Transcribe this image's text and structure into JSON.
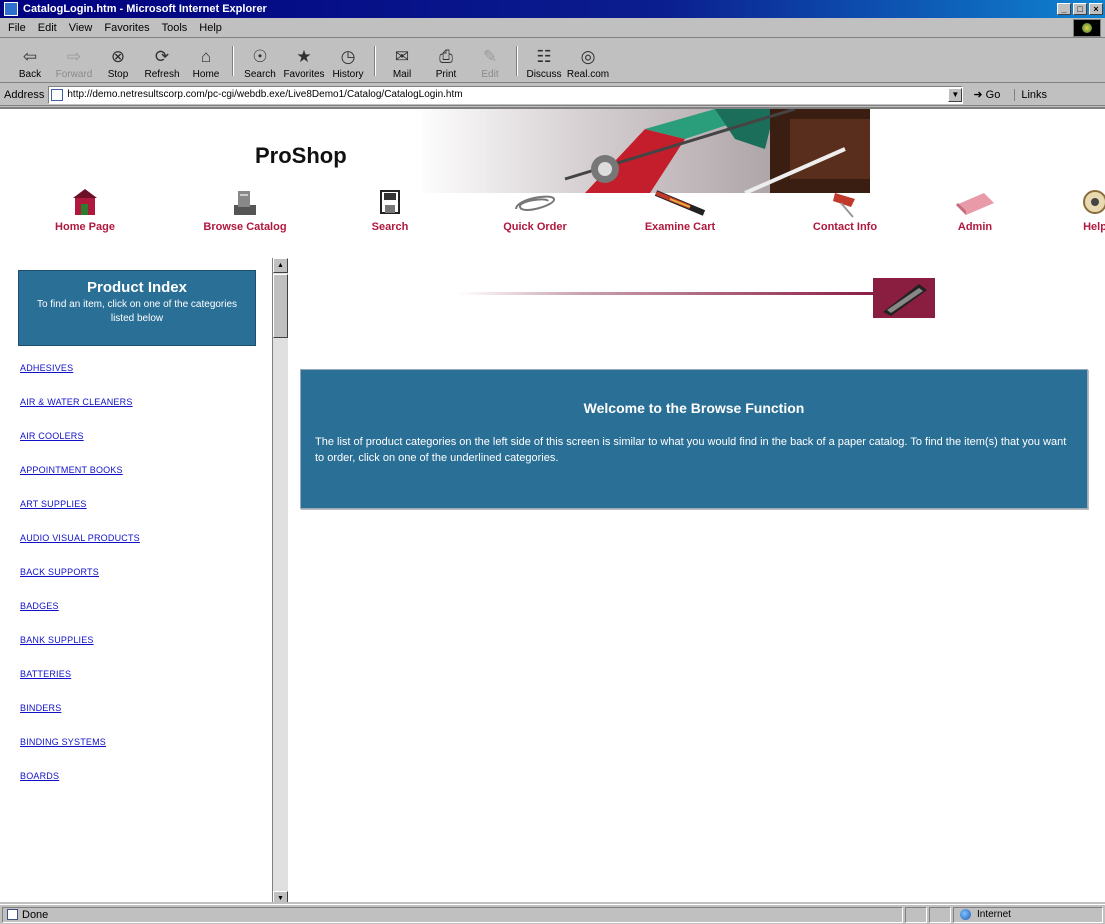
{
  "window": {
    "title": "CatalogLogin.htm - Microsoft Internet Explorer",
    "controls": [
      "_",
      "□",
      "×"
    ]
  },
  "menu": [
    "File",
    "Edit",
    "View",
    "Favorites",
    "Tools",
    "Help"
  ],
  "toolbar": [
    {
      "label": "Back",
      "icon": "back-arrow-icon",
      "glyph": "⇦",
      "enabled": true
    },
    {
      "label": "Forward",
      "icon": "forward-arrow-icon",
      "glyph": "⇨",
      "enabled": false
    },
    {
      "label": "Stop",
      "icon": "stop-icon",
      "glyph": "⊗",
      "enabled": true
    },
    {
      "label": "Refresh",
      "icon": "refresh-icon",
      "glyph": "⟳",
      "enabled": true
    },
    {
      "label": "Home",
      "icon": "home-icon",
      "glyph": "⌂",
      "enabled": true
    },
    {
      "label": "Search",
      "icon": "search-icon",
      "glyph": "☉",
      "enabled": true
    },
    {
      "label": "Favorites",
      "icon": "favorites-icon",
      "glyph": "★",
      "enabled": true
    },
    {
      "label": "History",
      "icon": "history-icon",
      "glyph": "◷",
      "enabled": true
    },
    {
      "label": "Mail",
      "icon": "mail-icon",
      "glyph": "✉",
      "enabled": true
    },
    {
      "label": "Print",
      "icon": "print-icon",
      "glyph": "⎙",
      "enabled": true
    },
    {
      "label": "Edit",
      "icon": "edit-icon",
      "glyph": "✎",
      "enabled": false
    },
    {
      "label": "Discuss",
      "icon": "discuss-icon",
      "glyph": "☷",
      "enabled": true
    },
    {
      "label": "Real.com",
      "icon": "realcom-icon",
      "glyph": "◎",
      "enabled": true
    }
  ],
  "address": {
    "label": "Address",
    "url": "http://demo.netresultscorp.com/pc-cgi/webdb.exe/Live8Demo1/Catalog/CatalogLogin.htm",
    "go": "Go",
    "links": "Links"
  },
  "site": {
    "name": "ProShop",
    "nav": [
      {
        "label": "Home Page",
        "icon": "home-page-icon",
        "color": "#b0183e"
      },
      {
        "label": "Browse Catalog",
        "icon": "browse-catalog-icon",
        "color": "#555555"
      },
      {
        "label": "Search",
        "icon": "search-page-icon",
        "color": "#333333"
      },
      {
        "label": "Quick Order",
        "icon": "quick-order-icon",
        "color": "#888888"
      },
      {
        "label": "Examine Cart",
        "icon": "examine-cart-icon",
        "color": "#c0392b"
      },
      {
        "label": "Contact Info",
        "icon": "contact-info-icon",
        "color": "#c0392b"
      },
      {
        "label": "Admin",
        "icon": "admin-icon",
        "color": "#e89aa8"
      },
      {
        "label": "Help",
        "icon": "help-icon",
        "color": "#8a6d3b"
      }
    ]
  },
  "sidebar": {
    "title": "Product Index",
    "subtitle": "To find an item, click on one of the categories listed below",
    "categories": [
      "ADHESIVES",
      "AIR & WATER CLEANERS",
      "AIR COOLERS",
      "APPOINTMENT BOOKS",
      "ART SUPPLIES",
      "AUDIO VISUAL PRODUCTS",
      "BACK SUPPORTS",
      "BADGES",
      "BANK SUPPLIES",
      "BATTERIES",
      "BINDERS",
      "BINDING SYSTEMS",
      "BOARDS"
    ]
  },
  "main": {
    "welcome_title": "Welcome to the Browse Function",
    "welcome_body": "The list of product categories on the left side of this screen is similar to what you would find in the back of a paper catalog. To find the item(s) that you want to order, click on one of the underlined categories."
  },
  "status": {
    "text": "Done",
    "zone": "Internet"
  },
  "colors": {
    "panel_blue": "#2a6f96",
    "nav_label": "#b0183e",
    "link": "#1010c8"
  }
}
